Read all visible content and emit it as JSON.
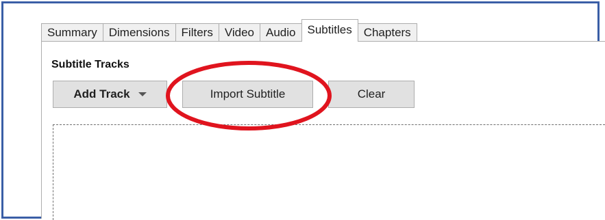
{
  "tabs": [
    {
      "label": "Summary",
      "active": false
    },
    {
      "label": "Dimensions",
      "active": false
    },
    {
      "label": "Filters",
      "active": false
    },
    {
      "label": "Video",
      "active": false
    },
    {
      "label": "Audio",
      "active": false
    },
    {
      "label": "Subtitles",
      "active": true
    },
    {
      "label": "Chapters",
      "active": false
    }
  ],
  "section": {
    "title": "Subtitle Tracks"
  },
  "buttons": {
    "add_track": "Add Track",
    "import_subtitle": "Import Subtitle",
    "clear": "Clear"
  },
  "colors": {
    "frame_border": "#3a5ea6",
    "annotation": "#e0141e",
    "button_bg": "#e1e1e1"
  }
}
